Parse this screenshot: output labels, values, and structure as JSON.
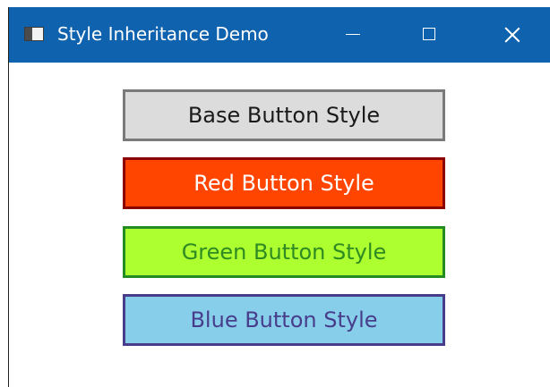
{
  "window": {
    "title": "Style Inheritance Demo",
    "icon": "app-window-icon",
    "controls": {
      "minimize": "minimize-icon",
      "maximize": "maximize-icon",
      "close": "close-icon"
    }
  },
  "buttons": [
    {
      "label": "Base Button Style",
      "background": "#dcdcdc",
      "border": "#7a7a7a",
      "text": "#1a1a1a"
    },
    {
      "label": "Red Button Style",
      "background": "#ff4500",
      "border": "#8b0000",
      "text": "#ffffff"
    },
    {
      "label": "Green Button Style",
      "background": "#adff2f",
      "border": "#228b22",
      "text": "#2e8b22"
    },
    {
      "label": "Blue Button Style",
      "background": "#87ceeb",
      "border": "#483d8b",
      "text": "#483d8b"
    }
  ]
}
